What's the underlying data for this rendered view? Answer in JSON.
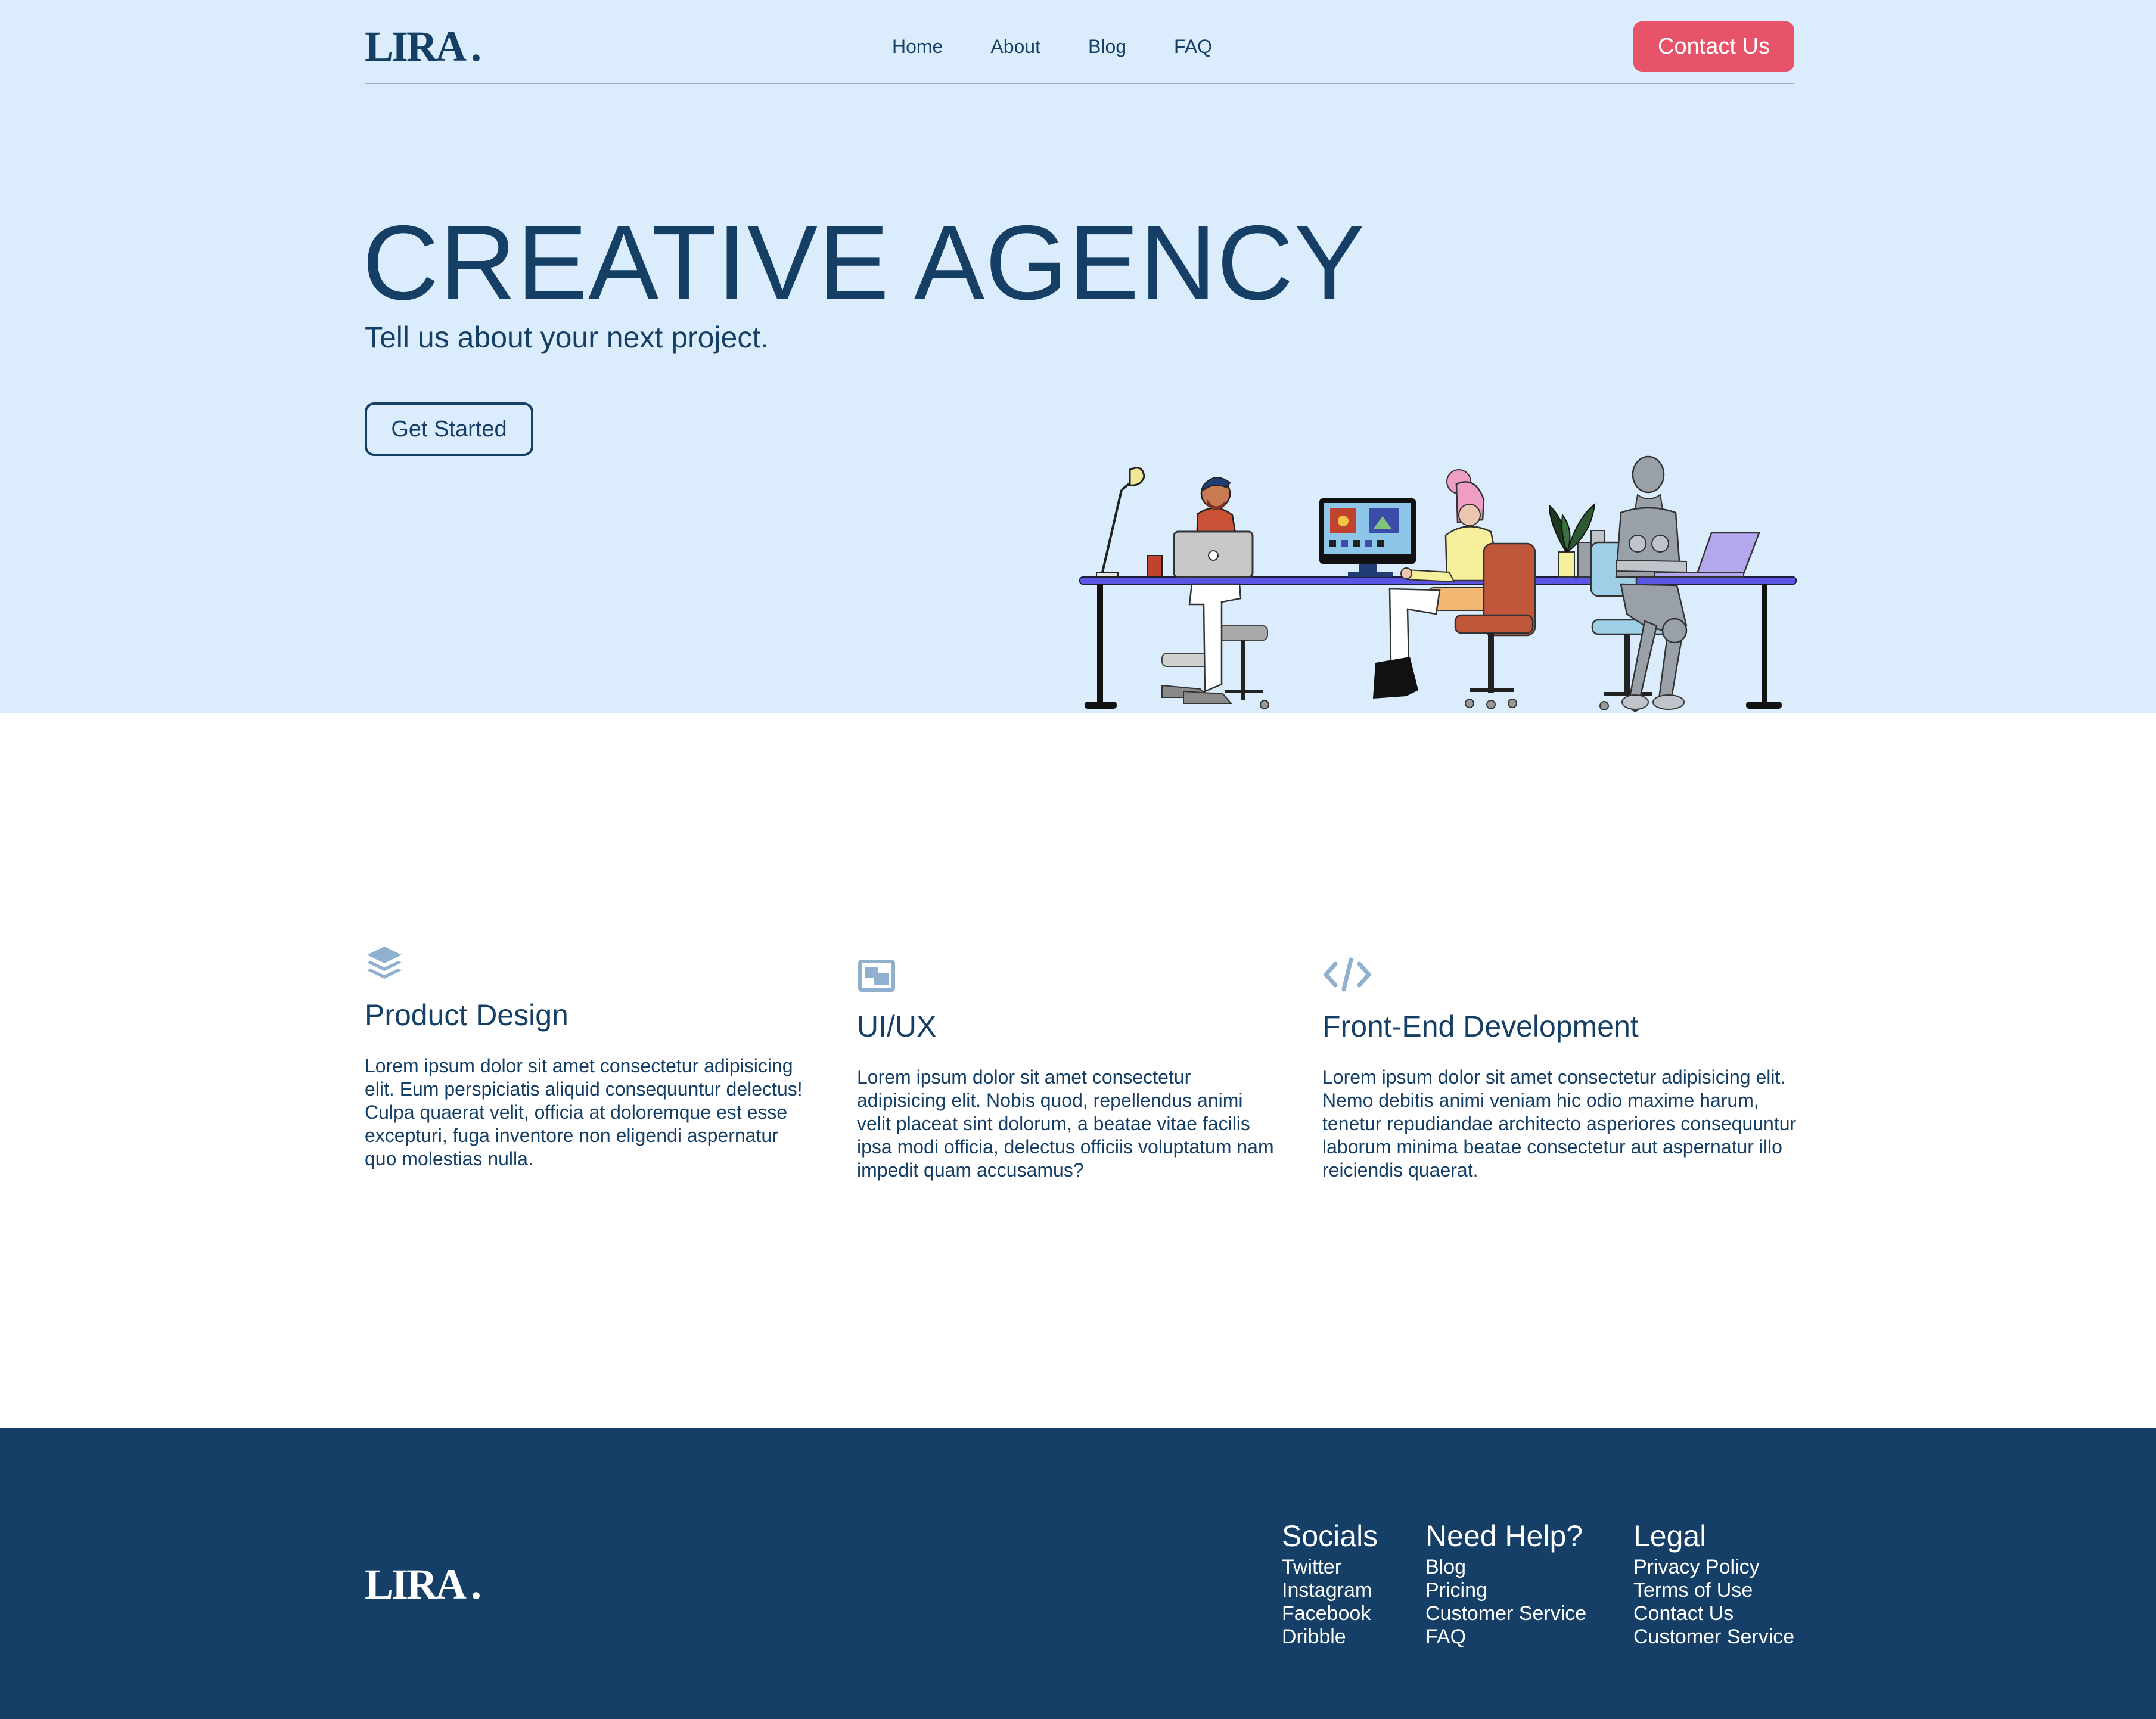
{
  "brand": {
    "name": "LIRA",
    "dot": "."
  },
  "nav": {
    "items": [
      "Home",
      "About",
      "Blog",
      "FAQ"
    ],
    "contact_label": "Contact Us"
  },
  "hero": {
    "title": "CREATIVE AGENCY",
    "subtitle": "Tell us about your next project.",
    "cta_label": "Get Started"
  },
  "features": [
    {
      "icon": "layers-icon",
      "title": "Product Design",
      "text": "Lorem ipsum dolor sit amet consectetur adipisicing elit. Eum perspiciatis aliquid consequuntur delectus! Culpa quaerat velit, officia at doloremque est esse excepturi, fuga inventore non eligendi aspernatur quo molestias nulla."
    },
    {
      "icon": "image-frame-icon",
      "title": "UI/UX",
      "text": "Lorem ipsum dolor sit amet consectetur adipisicing elit. Nobis quod, repellendus animi velit placeat sint dolorum, a beatae vitae facilis ipsa modi officia, delectus officiis voluptatum nam impedit quam accusamus?"
    },
    {
      "icon": "code-icon",
      "title": "Front-End Development",
      "text": "Lorem ipsum dolor sit amet consectetur adipisicing elit. Nemo debitis animi veniam hic odio maxime harum, tenetur repudiandae architecto asperiores consequuntur laborum minima beatae consectetur aut aspernatur illo reiciendis quaerat."
    }
  ],
  "footer": {
    "columns": [
      {
        "title": "Socials",
        "links": [
          "Twitter",
          "Instagram",
          "Facebook",
          "Dribble"
        ]
      },
      {
        "title": "Need Help?",
        "links": [
          "Blog",
          "Pricing",
          "Customer Service",
          "FAQ"
        ]
      },
      {
        "title": "Legal",
        "links": [
          "Privacy Policy",
          "Terms of Use",
          "Contact Us",
          "Customer Service"
        ]
      }
    ]
  },
  "colors": {
    "navy": "#163f66",
    "hero_bg": "#dbedfc",
    "accent_red": "#e7546a",
    "icon_blue": "#8fb0cf",
    "footer_bg": "#153f66"
  }
}
